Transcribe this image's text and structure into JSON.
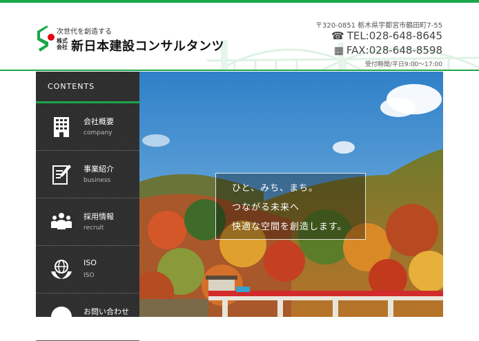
{
  "header": {
    "tagline": "次世代を創造する",
    "kaisha": "株式会社",
    "company_name": "新日本建設コンサルタンツ",
    "address": "〒320-0851 栃木県宇都宮市鶴田町7-55",
    "tel": "TEL:028-648-8645",
    "fax": "FAX:028-648-8598",
    "hours": "受付時間/平日9:00～17:00"
  },
  "sidebar": {
    "heading": "CONTENTS",
    "items": [
      {
        "label": "会社概要",
        "sub": "company",
        "icon": "building-icon"
      },
      {
        "label": "事業紹介",
        "sub": "business",
        "icon": "document-pen-icon"
      },
      {
        "label": "採用情報",
        "sub": "recruit",
        "icon": "people-icon"
      },
      {
        "label": "ISO",
        "sub": "ISO",
        "icon": "globe-hands-icon"
      },
      {
        "label": "お問い合わせ",
        "sub": "",
        "icon": "mail-icon"
      }
    ]
  },
  "hero": {
    "catch_lines": [
      "ひと、みち、まち。",
      "つながる未来へ",
      "快適な空間を創造します。"
    ]
  },
  "colors": {
    "brand_green": "#1aa84a",
    "logo_red": "#e60012",
    "sidebar_dark": "#2e2e2e"
  }
}
